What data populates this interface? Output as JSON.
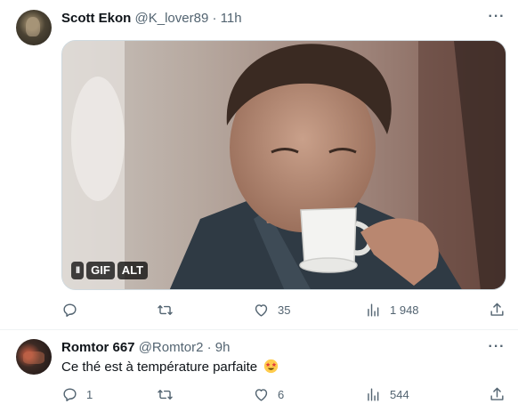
{
  "tweets": [
    {
      "author_name": "Scott Ekon",
      "handle": "@K_lover89",
      "separator": "·",
      "time": "11h",
      "more_label": "···",
      "media": {
        "type": "gif",
        "badges": [
          "II",
          "GIF",
          "ALT"
        ]
      },
      "actions": {
        "reply_count": "",
        "retweet_count": "",
        "like_count": "35",
        "view_count": "1 948"
      },
      "icons": [
        "reply-icon",
        "retweet-icon",
        "heart-icon",
        "views-icon",
        "share-icon"
      ]
    },
    {
      "author_name": "Romtor 667",
      "handle": "@Romtor2",
      "separator": "·",
      "time": "9h",
      "more_label": "···",
      "text": "Ce thé est à température parfaite",
      "emoji": "star-struck-emoji",
      "actions": {
        "reply_count": "1",
        "retweet_count": "",
        "like_count": "6",
        "view_count": "544"
      },
      "icons": [
        "reply-icon",
        "retweet-icon",
        "heart-icon",
        "views-icon",
        "share-icon"
      ]
    }
  ],
  "colors": {
    "text_primary": "#0f1419",
    "text_secondary": "#536471",
    "divider": "#eff3f4"
  }
}
